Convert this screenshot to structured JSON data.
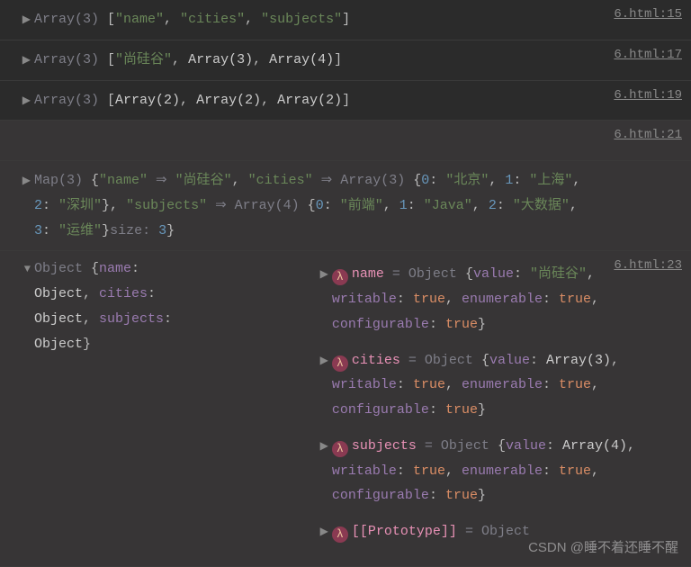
{
  "source_file": "6.html",
  "rows": [
    {
      "line": "15",
      "type": "array",
      "size": "3",
      "items_type": "strings",
      "items": [
        "name",
        "cities",
        "subjects"
      ]
    },
    {
      "line": "17",
      "type": "array",
      "size": "3",
      "mixed_first": "尚硅谷",
      "mixed_rest": [
        "Array(3)",
        "Array(4)"
      ]
    },
    {
      "line": "19",
      "type": "array",
      "size": "3",
      "arrays": [
        "Array(2)",
        "Array(2)",
        "Array(2)"
      ]
    },
    {
      "line": "21",
      "type": "blank"
    },
    {
      "line": "",
      "type": "map",
      "size": "3",
      "entry1_key": "name",
      "entry1_val": "尚硅谷",
      "entry2_key": "cities",
      "entry2_arr": "Array(3)",
      "entry2_vals": [
        "北京",
        "上海",
        "深圳"
      ],
      "entry3_key": "subjects",
      "entry3_arr": "Array(4)",
      "entry3_vals": [
        "前端",
        "Java",
        "大数据",
        "运维"
      ],
      "size_label": "size",
      "size_val": "3"
    }
  ],
  "object_block": {
    "line": "23",
    "header_label": "Object",
    "header_keys": [
      "name",
      "cities",
      "subjects"
    ],
    "header_type": "Object",
    "props": [
      {
        "name": "name",
        "value_label": "value",
        "value": "\"尚硅谷\"",
        "writable": "true",
        "enumerable": "true",
        "configurable": "true"
      },
      {
        "name": "cities",
        "value_label": "value",
        "value": "Array(3)",
        "writable": "true",
        "enumerable": "true",
        "configurable": "true"
      },
      {
        "name": "subjects",
        "value_label": "value",
        "value": "Array(4)",
        "writable": "true",
        "enumerable": "true",
        "configurable": "true"
      }
    ],
    "proto_label": "[[Prototype]]",
    "proto_val": "Object",
    "descriptor_labels": {
      "writable": "writable",
      "enumerable": "enumerable",
      "configurable": "configurable"
    }
  },
  "watermark": "CSDN @睡不着还睡不醒"
}
